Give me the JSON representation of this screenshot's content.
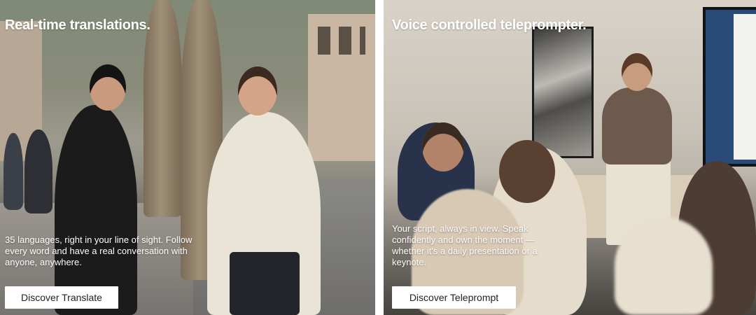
{
  "cards": [
    {
      "title": "Real-time translations.",
      "description": "35 languages, right in your line of sight. Follow every word and have a real conversation with anyone, anywhere.",
      "cta_label": "Discover Translate"
    },
    {
      "title": "Voice controlled teleprompter.",
      "description": "Your script, always in view. Speak confidently and own the moment — whether it's a daily presentation or a keynote.",
      "cta_label": "Discover Teleprompt"
    }
  ],
  "colors": {
    "overlay_text": "#ffffff",
    "button_bg": "#ffffff",
    "button_text": "#222222"
  }
}
